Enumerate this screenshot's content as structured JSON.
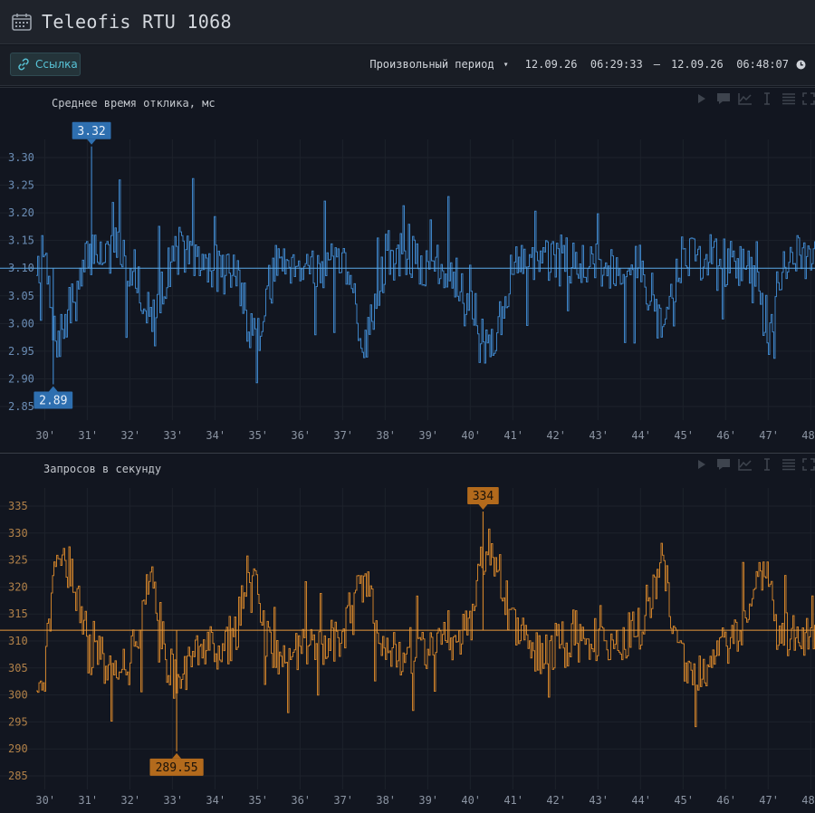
{
  "window": {
    "title": "Teleofis RTU 1068"
  },
  "toolbar": {
    "link_label": "Ссылка",
    "period_select": "Произвольный период",
    "range_start": "12.09.26  06:29:33",
    "range_sep": "—",
    "range_end": "12.09.26  06:48:07"
  },
  "colors": {
    "series_a": "#3d82c4",
    "series_b": "#c97f2a",
    "bg": "#121620"
  },
  "chart_data": [
    {
      "type": "line",
      "title": "Среднее время отклика, мс",
      "x_ticks": [
        "30'",
        "31'",
        "32'",
        "33'",
        "34'",
        "35'",
        "36'",
        "37'",
        "38'",
        "39'",
        "40'",
        "41'",
        "42'",
        "43'",
        "44'",
        "45'",
        "46'",
        "47'",
        "48'"
      ],
      "y_ticks": [
        "3.30",
        "3.25",
        "3.20",
        "3.15",
        "3.10",
        "3.05",
        "3.00",
        "2.95",
        "2.90",
        "2.85"
      ],
      "ylim": [
        2.85,
        3.3
      ],
      "xlim": [
        29.8,
        48.1
      ],
      "mean": 3.1,
      "max": {
        "value": "3.32",
        "x": 31.1
      },
      "min": {
        "value": "2.89",
        "x": 30.2
      },
      "grid": true,
      "series": [
        {
          "color": "#3d82c4",
          "anchors": [
            [
              29.8,
              3.11
            ],
            [
              30.0,
              3.12
            ],
            [
              30.2,
              2.97
            ],
            [
              30.4,
              2.98
            ],
            [
              30.6,
              3.03
            ],
            [
              30.8,
              3.06
            ],
            [
              31.0,
              3.12
            ],
            [
              31.2,
              3.14
            ],
            [
              31.4,
              3.12
            ],
            [
              31.7,
              3.14
            ],
            [
              32.0,
              3.1
            ],
            [
              32.2,
              3.08
            ],
            [
              32.4,
              3.01
            ],
            [
              32.6,
              3.0
            ],
            [
              32.8,
              3.08
            ],
            [
              33.0,
              3.12
            ],
            [
              33.2,
              3.14
            ],
            [
              33.5,
              3.11
            ],
            [
              34.0,
              3.1
            ],
            [
              34.5,
              3.09
            ],
            [
              34.8,
              3.0
            ],
            [
              35.0,
              2.97
            ],
            [
              35.2,
              3.05
            ],
            [
              35.5,
              3.12
            ],
            [
              36.0,
              3.11
            ],
            [
              36.5,
              3.1
            ],
            [
              37.0,
              3.1
            ],
            [
              37.3,
              3.02
            ],
            [
              37.5,
              2.96
            ],
            [
              37.7,
              3.02
            ],
            [
              38.0,
              3.12
            ],
            [
              38.5,
              3.12
            ],
            [
              39.0,
              3.1
            ],
            [
              39.5,
              3.1
            ],
            [
              40.0,
              3.06
            ],
            [
              40.2,
              2.97
            ],
            [
              40.4,
              2.96
            ],
            [
              40.6,
              2.98
            ],
            [
              40.8,
              3.05
            ],
            [
              41.0,
              3.1
            ],
            [
              41.5,
              3.11
            ],
            [
              42.0,
              3.11
            ],
            [
              42.5,
              3.12
            ],
            [
              43.0,
              3.1
            ],
            [
              43.5,
              3.1
            ],
            [
              44.0,
              3.1
            ],
            [
              44.3,
              3.04
            ],
            [
              44.5,
              2.98
            ],
            [
              44.7,
              3.05
            ],
            [
              45.0,
              3.13
            ],
            [
              45.5,
              3.12
            ],
            [
              46.0,
              3.11
            ],
            [
              46.5,
              3.1
            ],
            [
              46.8,
              3.04
            ],
            [
              47.0,
              2.98
            ],
            [
              47.2,
              3.06
            ],
            [
              47.5,
              3.12
            ],
            [
              48.1,
              3.11
            ]
          ]
        }
      ]
    },
    {
      "type": "line",
      "title": "Запросов в секунду",
      "x_ticks": [
        "30'",
        "31'",
        "32'",
        "33'",
        "34'",
        "35'",
        "36'",
        "37'",
        "38'",
        "39'",
        "40'",
        "41'",
        "42'",
        "43'",
        "44'",
        "45'",
        "46'",
        "47'",
        "48'"
      ],
      "y_ticks": [
        "335",
        "330",
        "325",
        "320",
        "315",
        "310",
        "305",
        "300",
        "295",
        "290",
        "285"
      ],
      "ylim": [
        285,
        335
      ],
      "xlim": [
        29.8,
        48.1
      ],
      "mean": 312,
      "max": {
        "value": "334",
        "x": 40.3
      },
      "min": {
        "value": "289.55",
        "x": 33.1
      },
      "grid": true,
      "series": [
        {
          "color": "#c97f2a",
          "anchors": [
            [
              29.8,
              303
            ],
            [
              30.0,
              304
            ],
            [
              30.2,
              324
            ],
            [
              30.5,
              325
            ],
            [
              30.8,
              318
            ],
            [
              31.0,
              308
            ],
            [
              31.5,
              306
            ],
            [
              32.0,
              306
            ],
            [
              32.2,
              312
            ],
            [
              32.4,
              322
            ],
            [
              32.6,
              318
            ],
            [
              32.9,
              305
            ],
            [
              33.1,
              302
            ],
            [
              33.4,
              306
            ],
            [
              33.8,
              309
            ],
            [
              34.2,
              309
            ],
            [
              34.5,
              312
            ],
            [
              34.7,
              322
            ],
            [
              35.0,
              318
            ],
            [
              35.3,
              307
            ],
            [
              35.7,
              306
            ],
            [
              36.0,
              310
            ],
            [
              36.5,
              310
            ],
            [
              37.0,
              310
            ],
            [
              37.2,
              318
            ],
            [
              37.5,
              322
            ],
            [
              37.8,
              314
            ],
            [
              38.0,
              308
            ],
            [
              38.5,
              307
            ],
            [
              39.0,
              308
            ],
            [
              39.5,
              310
            ],
            [
              40.0,
              312
            ],
            [
              40.2,
              322
            ],
            [
              40.4,
              328
            ],
            [
              40.7,
              322
            ],
            [
              41.0,
              312
            ],
            [
              41.5,
              308
            ],
            [
              42.0,
              309
            ],
            [
              42.5,
              310
            ],
            [
              43.0,
              310
            ],
            [
              43.5,
              310
            ],
            [
              44.0,
              312
            ],
            [
              44.2,
              318
            ],
            [
              44.5,
              325
            ],
            [
              44.8,
              312
            ],
            [
              45.0,
              305
            ],
            [
              45.5,
              305
            ],
            [
              46.0,
              309
            ],
            [
              46.5,
              312
            ],
            [
              46.8,
              324
            ],
            [
              47.0,
              320
            ],
            [
              47.2,
              312
            ],
            [
              47.5,
              311
            ],
            [
              48.1,
              311
            ]
          ]
        }
      ]
    }
  ]
}
